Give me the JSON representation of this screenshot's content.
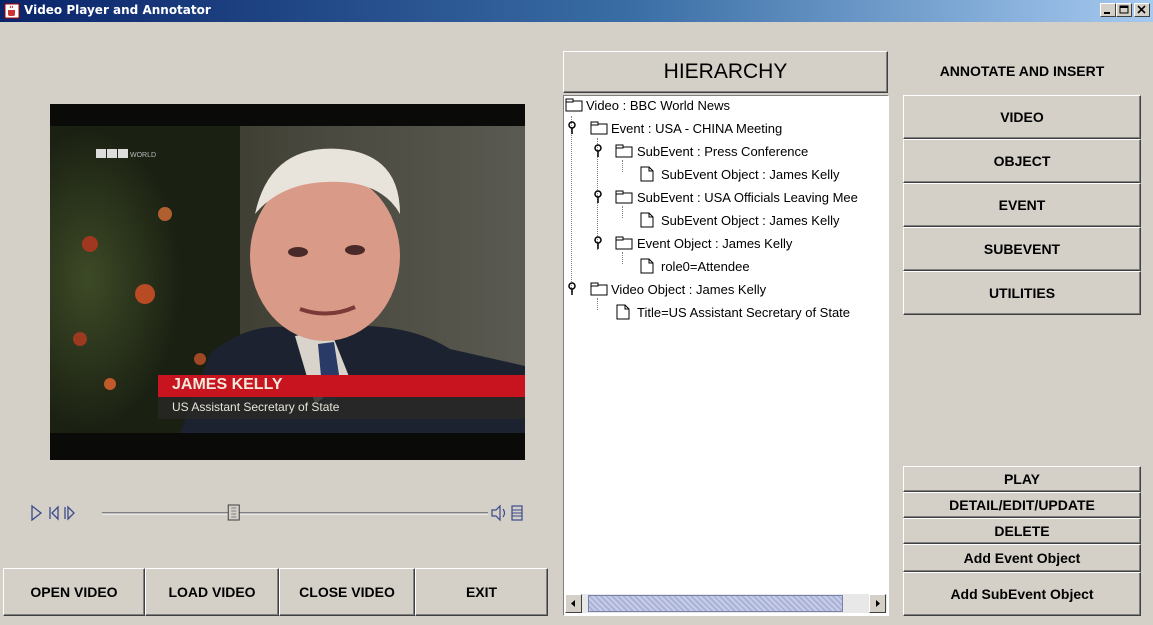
{
  "window": {
    "title": "Video Player and Annotator"
  },
  "video": {
    "logo": "BBC WORLD",
    "caption_name": "JAMES KELLY",
    "caption_role": "US Assistant Secretary of State"
  },
  "hierarchy": {
    "header": "HIERARCHY",
    "nodes": [
      {
        "label": "Video : BBC World News"
      },
      {
        "label": "Event : USA - CHINA Meeting"
      },
      {
        "label": "SubEvent : Press Conference"
      },
      {
        "label": "SubEvent Object : James Kelly"
      },
      {
        "label": "SubEvent : USA Officials Leaving Mee"
      },
      {
        "label": "SubEvent Object : James Kelly"
      },
      {
        "label": "Event Object : James Kelly"
      },
      {
        "label": "role0=Attendee"
      },
      {
        "label": "Video Object : James Kelly"
      },
      {
        "label": "Title=US Assistant Secretary of State"
      }
    ]
  },
  "annotate": {
    "header": "ANNOTATE AND INSERT",
    "buttons": [
      "VIDEO",
      "OBJECT",
      "EVENT",
      "SUBEVENT",
      "UTILITIES"
    ]
  },
  "actions": {
    "buttons": [
      "PLAY",
      "DETAIL/EDIT/UPDATE",
      "DELETE",
      "Add Event Object",
      "Add SubEvent Object"
    ]
  },
  "bottom": {
    "buttons": [
      "OPEN VIDEO",
      "LOAD VIDEO",
      "CLOSE VIDEO",
      "EXIT"
    ]
  },
  "player": {
    "position": 0.34
  },
  "colors": {
    "title_bar": "#0a246a",
    "caption_red": "#c8141e",
    "background": "#d4d0c8"
  }
}
